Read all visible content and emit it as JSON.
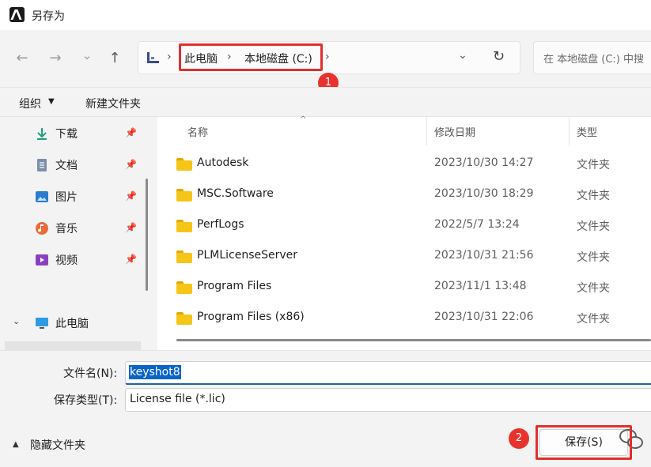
{
  "window": {
    "title": "另存为"
  },
  "nav": {
    "back_glyph": "←",
    "forward_glyph": "→",
    "recent_glyph": "⌄",
    "up_glyph": "↑"
  },
  "address": {
    "crumbs": [
      "此电脑",
      "本地磁盘 (C:)"
    ],
    "separator": "›",
    "dropdown_glyph": "⌄",
    "refresh_glyph": "↻"
  },
  "search": {
    "placeholder": "在 本地磁盘 (C:) 中搜"
  },
  "toolbar": {
    "organize": "组织",
    "organize_caret": "▼",
    "new_folder": "新建文件夹"
  },
  "sidebar": {
    "pin_glyph": "📌",
    "quick_access": [
      {
        "label": "下载",
        "icon": "download-icon"
      },
      {
        "label": "文档",
        "icon": "document-icon"
      },
      {
        "label": "图片",
        "icon": "picture-icon"
      },
      {
        "label": "音乐",
        "icon": "music-icon"
      },
      {
        "label": "视频",
        "icon": "video-icon"
      }
    ],
    "this_pc": {
      "label": "此电脑",
      "chevron": "⌄",
      "icon": "monitor-icon"
    }
  },
  "columns": {
    "name": "名称",
    "modified": "修改日期",
    "type": "类型",
    "sort_caret": "^"
  },
  "files": [
    {
      "name": "Autodesk",
      "modified": "2023/10/30 14:27",
      "type": "文件夹"
    },
    {
      "name": "MSC.Software",
      "modified": "2023/10/30 18:29",
      "type": "文件夹"
    },
    {
      "name": "PerfLogs",
      "modified": "2022/5/7 13:24",
      "type": "文件夹"
    },
    {
      "name": "PLMLicenseServer",
      "modified": "2023/10/31 21:56",
      "type": "文件夹"
    },
    {
      "name": "Program Files",
      "modified": "2023/11/1 13:48",
      "type": "文件夹"
    },
    {
      "name": "Program Files (x86)",
      "modified": "2023/10/31 22:06",
      "type": "文件夹"
    }
  ],
  "form": {
    "filename_label": "文件名(N):",
    "filename_value": "keyshot8",
    "filetype_label": "保存类型(T):",
    "filetype_value": "License file (*.lic)"
  },
  "footer": {
    "hide_folders": "隐藏文件夹",
    "hide_caret": "▲",
    "save_button": "保存(S)"
  },
  "annotations": {
    "badge1": "1",
    "badge2": "2",
    "highlight_color": "#e0302e"
  },
  "colors": {
    "accent": "#0a64c8",
    "folder": "#f5c518"
  }
}
